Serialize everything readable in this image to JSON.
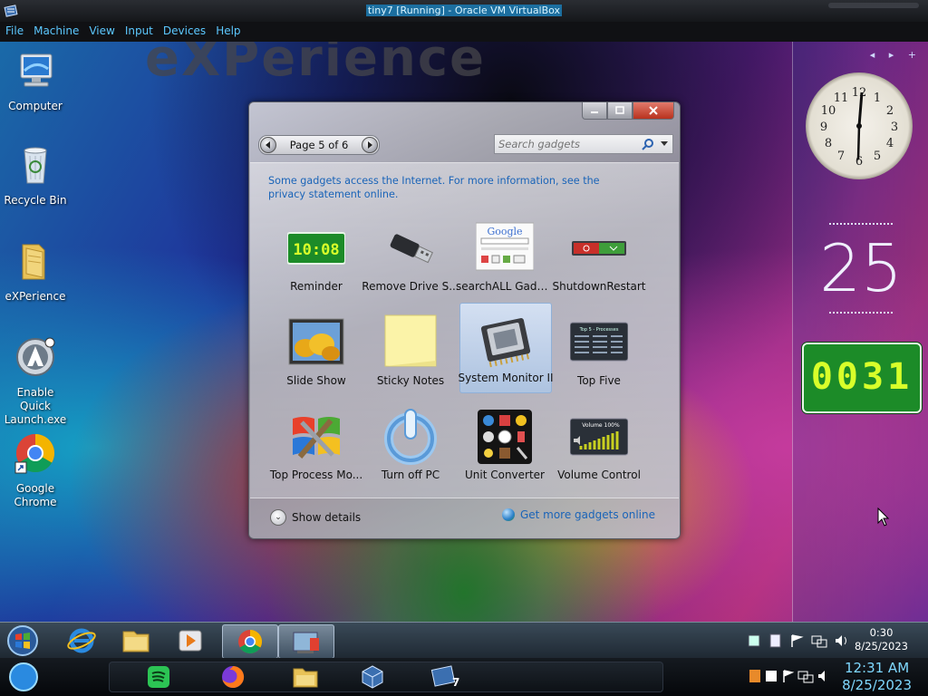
{
  "host": {
    "title": "tiny7 [Running] - Oracle VM VirtualBox",
    "menu": [
      "File",
      "Machine",
      "View",
      "Input",
      "Devices",
      "Help"
    ],
    "time": "12:31 AM",
    "date": "8/25/2023"
  },
  "desktop": {
    "wallpaper_text": "eXPerience",
    "icons": [
      {
        "label": "Computer"
      },
      {
        "label": "Recycle Bin"
      },
      {
        "label": "eXPerience"
      },
      {
        "label": "Enable Quick Launch.exe"
      },
      {
        "label": "Google Chrome"
      }
    ]
  },
  "sidebar": {
    "nav": "◂ ▸ +",
    "big_date": "25",
    "digital_clock": "0031"
  },
  "gadget_window": {
    "pager": "Page 5 of 6",
    "search_placeholder": "Search gadgets",
    "notice": "Some gadgets access the Internet.  For more information, see the privacy statement online.",
    "gadgets": [
      {
        "label": "Reminder"
      },
      {
        "label": "Remove Drive S..."
      },
      {
        "label": "searchALL Gadg..."
      },
      {
        "label": "ShutdownRestart"
      },
      {
        "label": "Slide Show"
      },
      {
        "label": "Sticky Notes"
      },
      {
        "label": "System Monitor II",
        "selected": true
      },
      {
        "label": "Top Five"
      },
      {
        "label": "Top Process Mo..."
      },
      {
        "label": "Turn off PC"
      },
      {
        "label": "Unit Converter"
      },
      {
        "label": "Volume Control"
      }
    ],
    "reminder_thumb_text": "10:08",
    "google_thumb_text": "Google",
    "topfive_thumb_text": "Top 5 - Processes",
    "volume_thumb_text": "Volume 100%",
    "show_details": "Show details",
    "get_more": "Get more gadgets online"
  },
  "taskbar": {
    "time": "0:30",
    "date": "8/25/2023"
  },
  "colors": {
    "link": "#1a64b8",
    "host_accent": "#5cc8ff",
    "digital_green": "#1c8b28",
    "digital_digits": "#d8ff2a"
  }
}
